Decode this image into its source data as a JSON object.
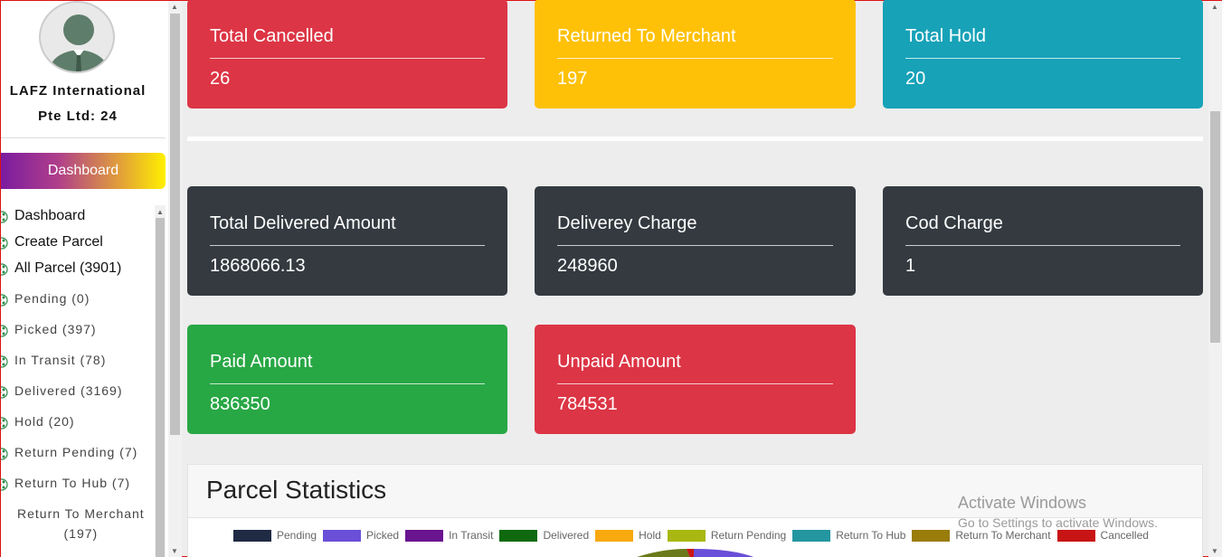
{
  "sidebar": {
    "company_name_line1": "LAFZ International",
    "company_name_line2": "Pte Ltd: 24",
    "dashboard_button": "Dashboard",
    "menu": [
      {
        "label": "Dashboard"
      },
      {
        "label": "Create Parcel"
      },
      {
        "label": "All Parcel (3901)"
      },
      {
        "label": "Pending (0)"
      },
      {
        "label": "Picked (397)"
      },
      {
        "label": "In Transit (78)"
      },
      {
        "label": "Delivered (3169)"
      },
      {
        "label": "Hold (20)"
      },
      {
        "label": "Return Pending (7)"
      },
      {
        "label": "Return To Hub (7)"
      },
      {
        "label": "Return To Merchant",
        "sub": "(197)"
      }
    ]
  },
  "cards": {
    "total_cancelled": {
      "label": "Total Cancelled",
      "value": "26",
      "color": "#dc3545"
    },
    "returned_to_merchant": {
      "label": "Returned To Merchant",
      "value": "197",
      "color": "#ffc107"
    },
    "total_hold": {
      "label": "Total Hold",
      "value": "20",
      "color": "#17a2b8"
    },
    "total_delivered_amount": {
      "label": "Total Delivered Amount",
      "value": "1868066.13",
      "color": "#343a40"
    },
    "delivery_charge": {
      "label": "Deliverey Charge",
      "value": "248960",
      "color": "#343a40"
    },
    "cod_charge": {
      "label": "Cod Charge",
      "value": "1",
      "color": "#343a40"
    },
    "paid_amount": {
      "label": "Paid Amount",
      "value": "836350",
      "color": "#28a745"
    },
    "unpaid_amount": {
      "label": "Unpaid Amount",
      "value": "784531",
      "color": "#dc3545"
    }
  },
  "statistics": {
    "title": "Parcel Statistics",
    "legend": [
      {
        "label": "Pending",
        "color": "#1f2a44"
      },
      {
        "label": "Picked",
        "color": "#6a4fd8"
      },
      {
        "label": "In Transit",
        "color": "#6a1490"
      },
      {
        "label": "Delivered",
        "color": "#0f6a0f"
      },
      {
        "label": "Hold",
        "color": "#f7a90e"
      },
      {
        "label": "Return Pending",
        "color": "#a9b810"
      },
      {
        "label": "Return To Hub",
        "color": "#2496a0"
      },
      {
        "label": "Return To Merchant",
        "color": "#9a7c0a"
      },
      {
        "label": "Cancelled",
        "color": "#c81414"
      }
    ]
  },
  "os_watermark": {
    "line1": "Activate Windows",
    "line2": "Go to Settings to activate Windows."
  }
}
